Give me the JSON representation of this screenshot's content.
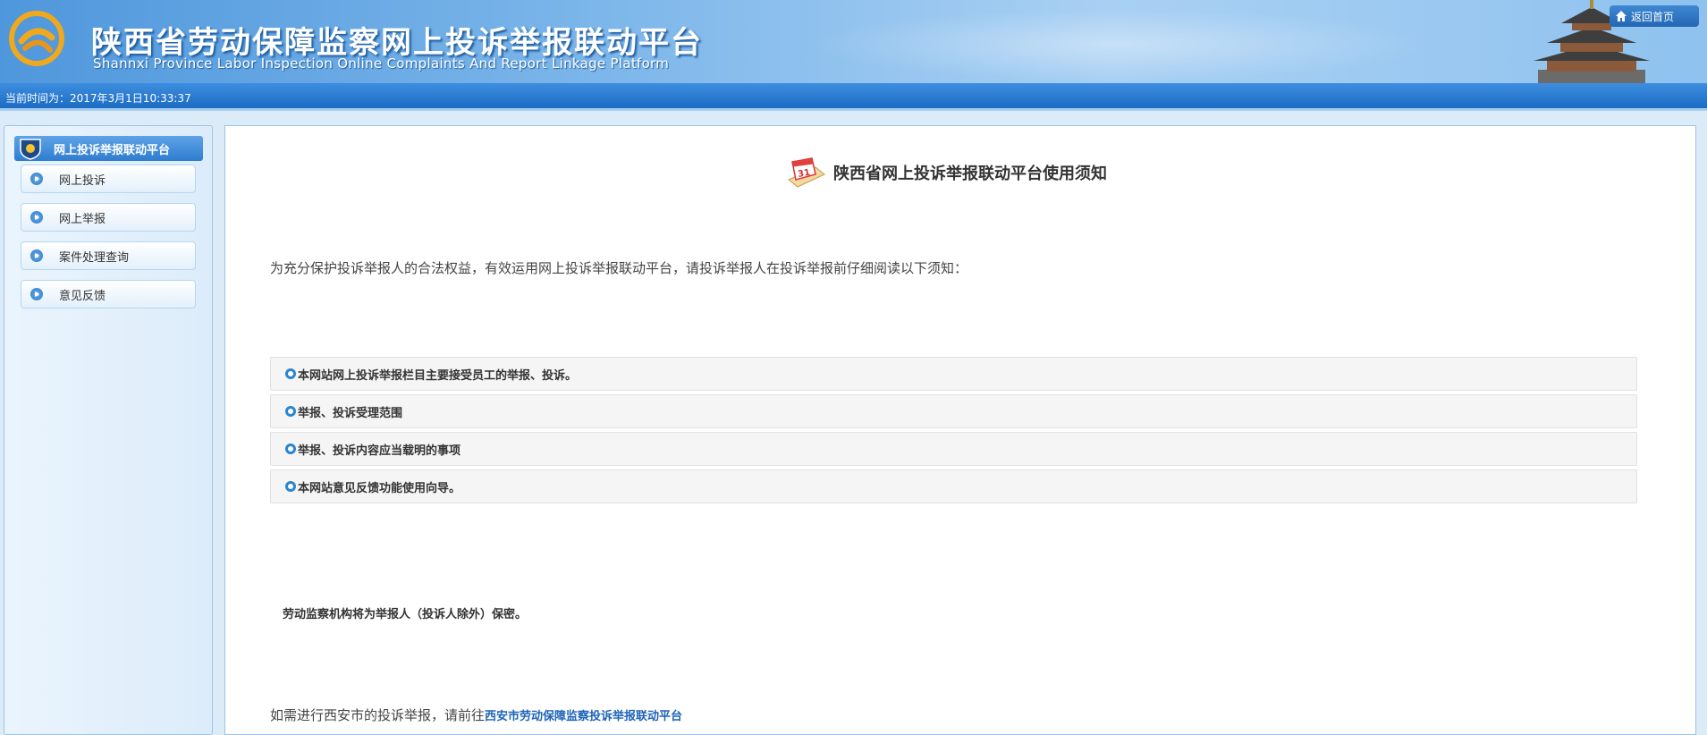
{
  "header": {
    "title_cn": "陕西省劳动保障监察网上投诉举报联动平台",
    "title_en": "Shannxi Province Labor Inspection Online Complaints And Report Linkage Platform",
    "home_link": "返回首页",
    "accent": "#2f7cd0"
  },
  "timebar": {
    "text": "当前时间为：2017年3月1日10:33:37"
  },
  "sidebar": {
    "heading": "网上投诉举报联动平台",
    "items": [
      {
        "label": "网上投诉"
      },
      {
        "label": "网上举报"
      },
      {
        "label": "案件处理查询"
      },
      {
        "label": "意见反馈"
      }
    ]
  },
  "main": {
    "title": "陕西省网上投诉举报联动平台使用须知",
    "intro": "为充分保护投诉举报人的合法权益，有效运用网上投诉举报联动平台，请投诉举报人在投诉举报前仔细阅读以下须知：",
    "sections": [
      {
        "label": "本网站网上投诉举报栏目主要接受员工的举报、投诉。"
      },
      {
        "label": "举报、投诉受理范围"
      },
      {
        "label": "举报、投诉内容应当载明的事项"
      },
      {
        "label": "本网站意见反馈功能使用向导。"
      }
    ],
    "confidential": "劳动监察机构将为举报人（投诉人除外）保密。",
    "xian_prefix": "如需进行西安市的投诉举报，请前往",
    "xian_link": "西安市劳动保障监察投诉举报联动平台"
  }
}
